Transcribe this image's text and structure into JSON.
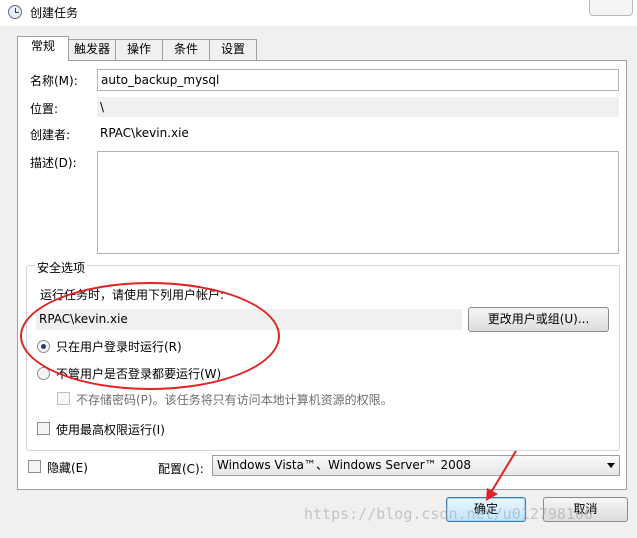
{
  "window": {
    "title": "创建任务"
  },
  "tabs": [
    {
      "label": "常规",
      "active": true
    },
    {
      "label": "触发器"
    },
    {
      "label": "操作"
    },
    {
      "label": "条件"
    },
    {
      "label": "设置"
    }
  ],
  "general": {
    "name_label": "名称(M):",
    "name_value": "auto_backup_mysql",
    "location_label": "位置:",
    "location_value": "\\",
    "author_label": "创建者:",
    "author_value": "RPAC\\kevin.xie",
    "description_label": "描述(D):",
    "description_value": ""
  },
  "security": {
    "group_title": "安全选项",
    "run_as_prompt": "运行任务时，请使用下列用户帐户:",
    "user_account": "RPAC\\kevin.xie",
    "change_user_button": "更改用户或组(U)...",
    "radio_logged_on": "只在用户登录时运行(R)",
    "radio_logged_on_selected": true,
    "radio_whether_logged": "不管用户是否登录都要运行(W)",
    "no_store_password": "不存储密码(P)。该任务将只有访问本地计算机资源的权限。",
    "highest_privileges": "使用最高权限运行(I)"
  },
  "bottom": {
    "hidden_label": "隐藏(E)",
    "configure_label": "配置(C):",
    "configure_value": "Windows Vista™、Windows Server™ 2008"
  },
  "buttons": {
    "ok": "确定",
    "cancel": "取消"
  },
  "watermark": "https://blog.csdn.net/u012798106",
  "colors": {
    "annotation_red": "#e02424"
  }
}
